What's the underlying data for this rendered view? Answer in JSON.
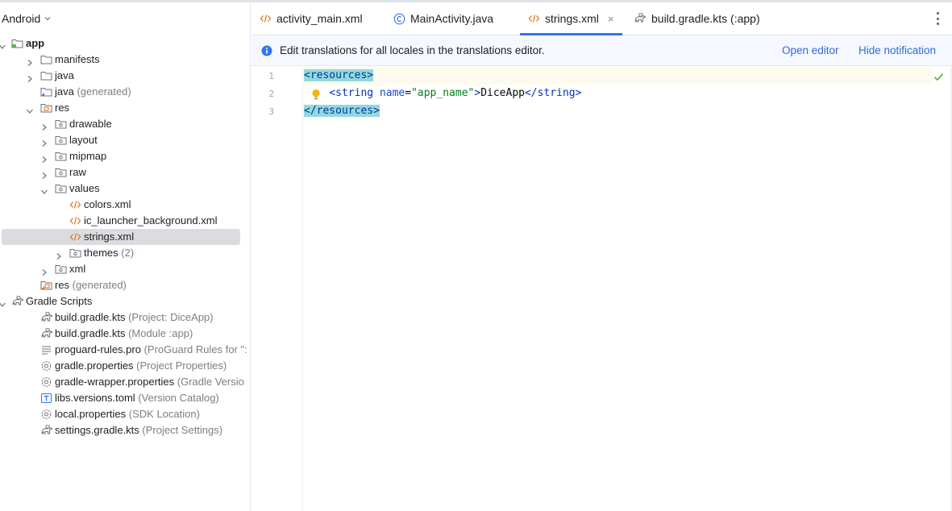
{
  "project_panel": {
    "view": "Android",
    "tree": [
      {
        "label": "app",
        "hint": "",
        "icon": "module-icon",
        "depth": 0,
        "arrow": "down",
        "bold": true
      },
      {
        "label": "manifests",
        "hint": "",
        "icon": "folder-icon",
        "depth": 1,
        "arrow": "right"
      },
      {
        "label": "java",
        "hint": "",
        "icon": "folder-icon",
        "depth": 1,
        "arrow": "right"
      },
      {
        "label": "java",
        "hint": "(generated)",
        "icon": "generated-folder-icon",
        "depth": 1,
        "arrow": "none"
      },
      {
        "label": "res",
        "hint": "",
        "icon": "res-folder-icon",
        "depth": 1,
        "arrow": "down"
      },
      {
        "label": "drawable",
        "hint": "",
        "icon": "package-folder-icon",
        "depth": 2,
        "arrow": "right"
      },
      {
        "label": "layout",
        "hint": "",
        "icon": "package-folder-icon",
        "depth": 2,
        "arrow": "right"
      },
      {
        "label": "mipmap",
        "hint": "",
        "icon": "package-folder-icon",
        "depth": 2,
        "arrow": "right"
      },
      {
        "label": "raw",
        "hint": "",
        "icon": "package-folder-icon",
        "depth": 2,
        "arrow": "right"
      },
      {
        "label": "values",
        "hint": "",
        "icon": "package-folder-icon",
        "depth": 2,
        "arrow": "down"
      },
      {
        "label": "colors.xml",
        "hint": "",
        "icon": "xml-file-icon",
        "depth": 3,
        "arrow": "none"
      },
      {
        "label": "ic_launcher_background.xml",
        "hint": "",
        "icon": "xml-file-icon",
        "depth": 3,
        "arrow": "none"
      },
      {
        "label": "strings.xml",
        "hint": "",
        "icon": "xml-file-icon",
        "depth": 3,
        "arrow": "none",
        "selected": true
      },
      {
        "label": "themes",
        "hint": "(2)",
        "icon": "package-folder-icon",
        "depth": 3,
        "arrow": "right"
      },
      {
        "label": "xml",
        "hint": "",
        "icon": "package-folder-icon",
        "depth": 2,
        "arrow": "right"
      },
      {
        "label": "res",
        "hint": "(generated)",
        "icon": "generated-res-folder-icon",
        "depth": 1,
        "arrow": "none"
      },
      {
        "label": "Gradle Scripts",
        "hint": "",
        "icon": "gradle-icon",
        "depth": 0,
        "arrow": "down"
      },
      {
        "label": "build.gradle.kts",
        "hint": "(Project: DiceApp)",
        "icon": "gradle-icon",
        "depth": 1,
        "arrow": "none"
      },
      {
        "label": "build.gradle.kts",
        "hint": "(Module :app)",
        "icon": "gradle-icon",
        "depth": 1,
        "arrow": "none"
      },
      {
        "label": "proguard-rules.pro",
        "hint": "(ProGuard Rules for \":",
        "icon": "text-file-icon",
        "depth": 1,
        "arrow": "none"
      },
      {
        "label": "gradle.properties",
        "hint": "(Project Properties)",
        "icon": "properties-icon",
        "depth": 1,
        "arrow": "none"
      },
      {
        "label": "gradle-wrapper.properties",
        "hint": "(Gradle Versio",
        "icon": "properties-icon",
        "depth": 1,
        "arrow": "none"
      },
      {
        "label": "libs.versions.toml",
        "hint": "(Version Catalog)",
        "icon": "toml-file-icon",
        "depth": 1,
        "arrow": "none"
      },
      {
        "label": "local.properties",
        "hint": "(SDK Location)",
        "icon": "properties-icon",
        "depth": 1,
        "arrow": "none"
      },
      {
        "label": "settings.gradle.kts",
        "hint": "(Project Settings)",
        "icon": "gradle-icon",
        "depth": 1,
        "arrow": "none"
      }
    ]
  },
  "tabs": [
    {
      "label": "activity_main.xml",
      "icon": "xml-file-icon",
      "active": false
    },
    {
      "label": "MainActivity.java",
      "icon": "java-class-icon",
      "active": false
    },
    {
      "label": "strings.xml",
      "icon": "xml-file-icon",
      "active": true,
      "close": "×"
    },
    {
      "label": "build.gradle.kts (:app)",
      "icon": "gradle-icon",
      "active": false
    }
  ],
  "notification": {
    "message": "Edit translations for all locales in the translations editor.",
    "open_editor": "Open editor",
    "hide": "Hide notification"
  },
  "editor": {
    "line_numbers": [
      "1",
      "2",
      "3"
    ],
    "lines": [
      {
        "parts": [
          {
            "t": "<resources>",
            "c": "tag match"
          }
        ],
        "current": true
      },
      {
        "parts": [
          {
            "t": "    ",
            "c": "txt"
          },
          {
            "t": "<string ",
            "c": "tag"
          },
          {
            "t": "name",
            "c": "attr"
          },
          {
            "t": "=",
            "c": "txt"
          },
          {
            "t": "\"app_name\"",
            "c": "str"
          },
          {
            "t": ">",
            "c": "tag"
          },
          {
            "t": "DiceApp",
            "c": "txt"
          },
          {
            "t": "</string>",
            "c": "tag"
          }
        ]
      },
      {
        "parts": [
          {
            "t": "</resources>",
            "c": "tag match"
          }
        ]
      }
    ]
  },
  "colors": {
    "accent": "#3574f0",
    "xml_icon": "#e0721c",
    "folder": "#6c707e",
    "tag": "#0033b3",
    "string": "#067d17",
    "bulb": "#f2b517",
    "check": "#5fb845"
  }
}
